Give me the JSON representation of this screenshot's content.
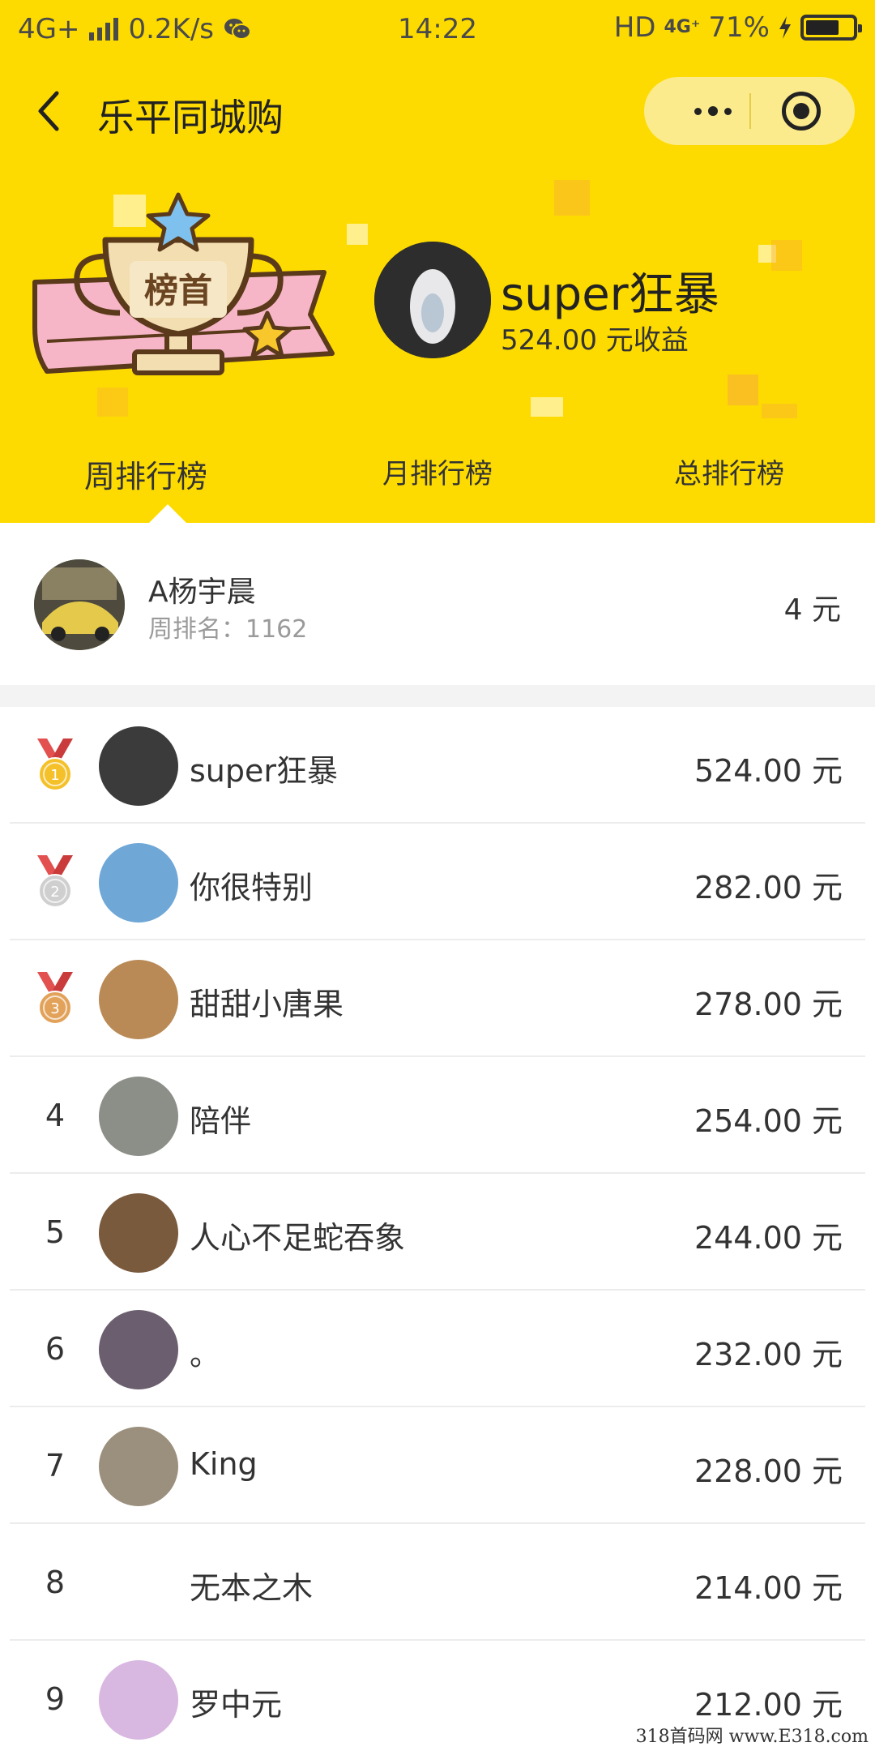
{
  "status_bar": {
    "left_network": "4G+",
    "speed": "0.2K/s",
    "time": "14:22",
    "hd": "HD",
    "network2": "4G⁺",
    "battery": "71%",
    "battery_level": 0.71
  },
  "nav": {
    "title": "乐平同城购",
    "back_icon": "chevron-left-icon",
    "more_icon": "more-dots-icon",
    "close_icon": "target-close-icon"
  },
  "trophy": {
    "text": "榜首"
  },
  "top_user": {
    "name": "super狂暴",
    "earnings": "524.00 元收益"
  },
  "tabs": [
    {
      "label": "周排行榜",
      "active": true
    },
    {
      "label": "月排行榜",
      "active": false
    },
    {
      "label": "总排行榜",
      "active": false
    }
  ],
  "my_rank": {
    "name": "A杨宇晨",
    "rank_text": "周排名：1162",
    "amount": "4 元"
  },
  "leaderboard": [
    {
      "rank": "1",
      "medal": "gold",
      "name": "super狂暴",
      "amount": "524.00 元",
      "avatar_color": "#3b3b3b"
    },
    {
      "rank": "2",
      "medal": "silver",
      "name": "你很特别",
      "amount": "282.00 元",
      "avatar_color": "#6fa7d6"
    },
    {
      "rank": "3",
      "medal": "bronze",
      "name": "甜甜小唐果",
      "amount": "278.00 元",
      "avatar_color": "#b98a55"
    },
    {
      "rank": "4",
      "medal": "",
      "name": "陪伴",
      "amount": "254.00 元",
      "avatar_color": "#8c8f88"
    },
    {
      "rank": "5",
      "medal": "",
      "name": "人心不足蛇吞象",
      "amount": "244.00 元",
      "avatar_color": "#7a5a3d"
    },
    {
      "rank": "6",
      "medal": "",
      "name": "。",
      "amount": "232.00 元",
      "avatar_color": "#6b5e6e"
    },
    {
      "rank": "7",
      "medal": "",
      "name": "King",
      "amount": "228.00 元",
      "avatar_color": "#9b8f7d"
    },
    {
      "rank": "8",
      "medal": "",
      "name": "无本之木",
      "amount": "214.00 元",
      "avatar_color": "#ffffff"
    },
    {
      "rank": "9",
      "medal": "",
      "name": "罗中元",
      "amount": "212.00 元",
      "avatar_color": "#d8b7e0"
    }
  ],
  "watermark": "318首码网 www.E318.com",
  "colors": {
    "header_yellow": "#FDDB00",
    "capsule": "#FCEB8C",
    "gold": "#F4C12B",
    "silver": "#CFCFCF",
    "bronze": "#E2A25A",
    "ribbon_red": "#E2504F"
  }
}
